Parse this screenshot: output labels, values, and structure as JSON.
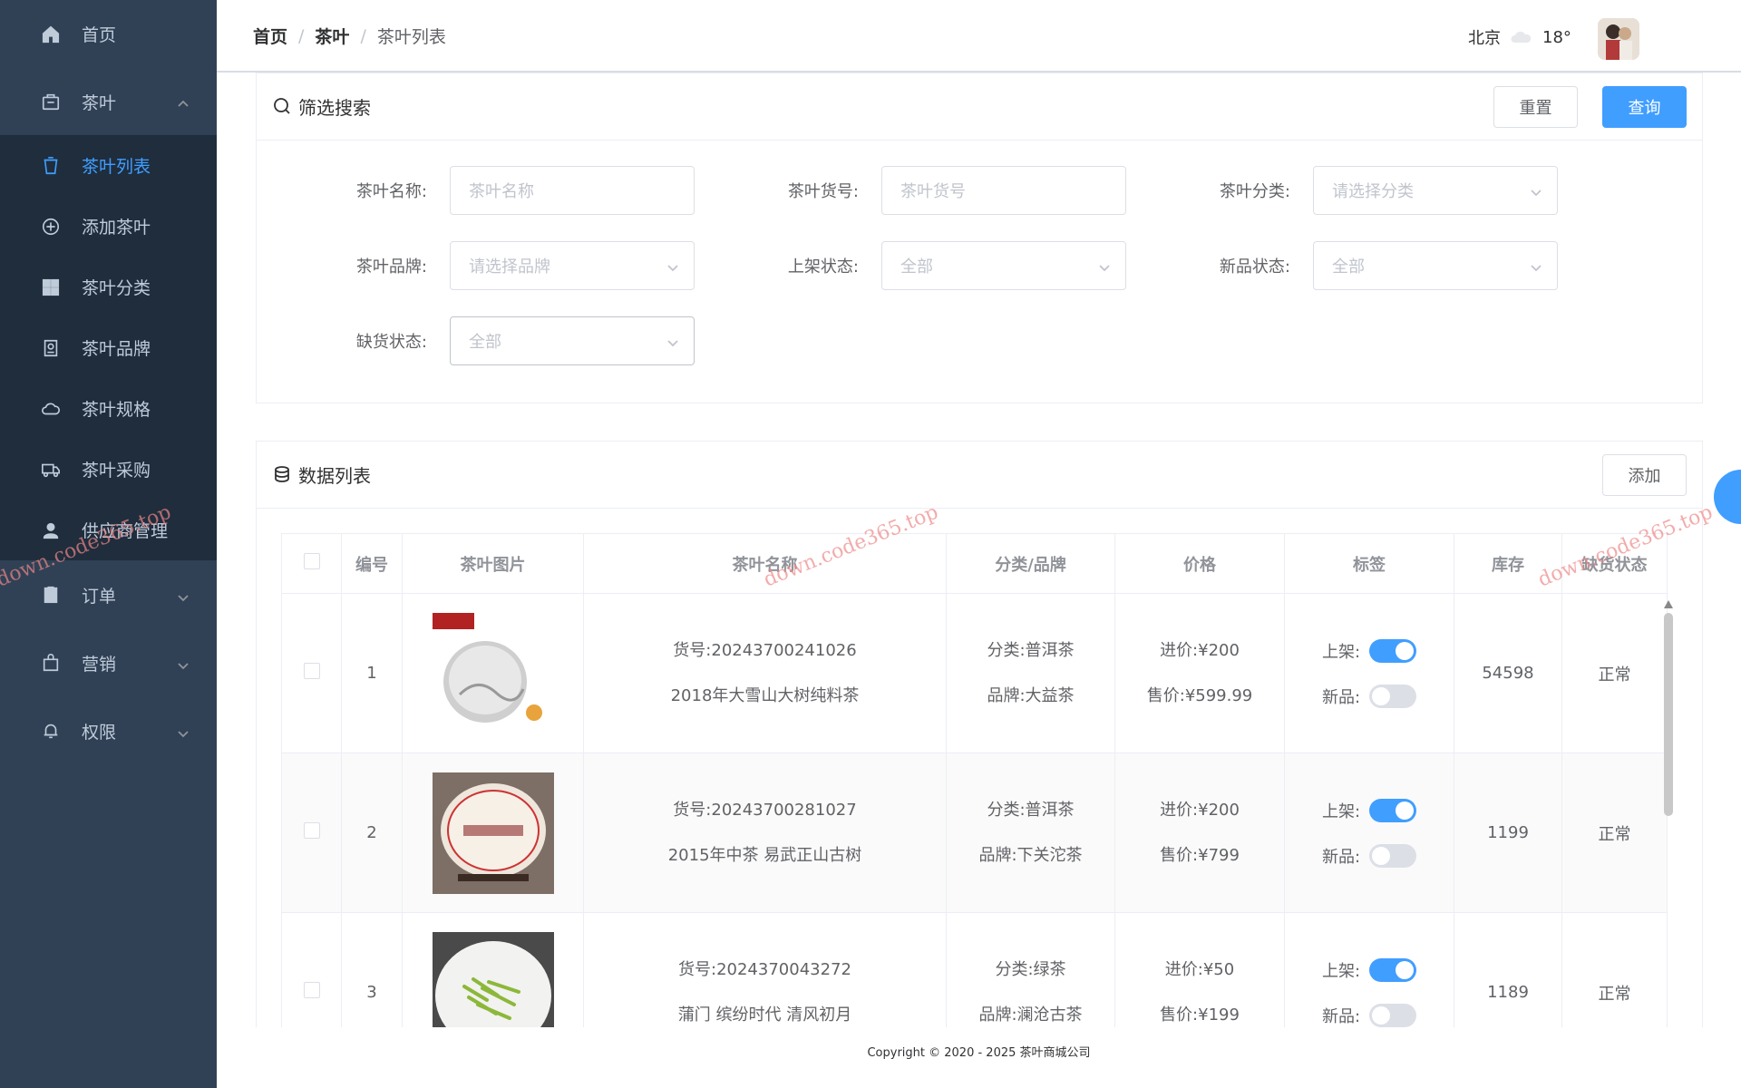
{
  "sidebar": {
    "items": [
      {
        "label": "首页"
      },
      {
        "label": "茶叶"
      },
      {
        "label": "茶叶列表"
      },
      {
        "label": "添加茶叶"
      },
      {
        "label": "茶叶分类"
      },
      {
        "label": "茶叶品牌"
      },
      {
        "label": "茶叶规格"
      },
      {
        "label": "茶叶采购"
      },
      {
        "label": "供应商管理"
      },
      {
        "label": "订单"
      },
      {
        "label": "营销"
      },
      {
        "label": "权限"
      }
    ]
  },
  "header": {
    "breadcrumb": [
      "首页",
      "茶叶",
      "茶叶列表"
    ],
    "city": "北京",
    "temperature": "18°"
  },
  "filter": {
    "title": "筛选搜索",
    "reset_label": "重置",
    "query_label": "查询",
    "fields": [
      {
        "label": "茶叶名称:",
        "placeholder": "茶叶名称"
      },
      {
        "label": "茶叶货号:",
        "placeholder": "茶叶货号"
      },
      {
        "label": "茶叶分类:",
        "placeholder": "请选择分类"
      },
      {
        "label": "茶叶品牌:",
        "placeholder": "请选择品牌"
      },
      {
        "label": "上架状态:",
        "placeholder": "全部"
      },
      {
        "label": "新品状态:",
        "placeholder": "全部"
      },
      {
        "label": "缺货状态:",
        "placeholder": "全部"
      }
    ]
  },
  "list": {
    "title": "数据列表",
    "add_label": "添加",
    "columns": [
      "编号",
      "茶叶图片",
      "茶叶名称",
      "分类/品牌",
      "价格",
      "标签",
      "库存",
      "缺货状态"
    ],
    "rows": [
      {
        "id": "1",
        "sku": "货号:20243700241026",
        "name": "2018年大雪山大树纯料茶",
        "category": "分类:普洱茶",
        "brand": "品牌:大益茶",
        "cost": "进价:¥200",
        "price": "售价:¥599.99",
        "on_label": "上架:",
        "new_label": "新品:",
        "on": true,
        "new": false,
        "stock": "54598",
        "status": "正常"
      },
      {
        "id": "2",
        "sku": "货号:20243700281027",
        "name": "2015年中茶 易武正山古树",
        "category": "分类:普洱茶",
        "brand": "品牌:下关沱茶",
        "cost": "进价:¥200",
        "price": "售价:¥799",
        "on_label": "上架:",
        "new_label": "新品:",
        "on": true,
        "new": false,
        "stock": "1199",
        "status": "正常"
      },
      {
        "id": "3",
        "sku": "货号:2024370043272",
        "name": "蒲门 缤纷时代 清风初月",
        "category": "分类:绿茶",
        "brand": "品牌:澜沧古茶",
        "cost": "进价:¥50",
        "price": "售价:¥199",
        "on_label": "上架:",
        "new_label": "新品:",
        "on": true,
        "new": false,
        "stock": "1189",
        "status": "正常"
      }
    ]
  },
  "footer": {
    "text": "Copyright © 2020 - 2025  茶叶商城公司"
  },
  "watermark": {
    "text": "down.code365.top"
  },
  "colors": {
    "sidebar": "#304156",
    "submenu": "#1f2d3d",
    "accent": "#409eff"
  }
}
